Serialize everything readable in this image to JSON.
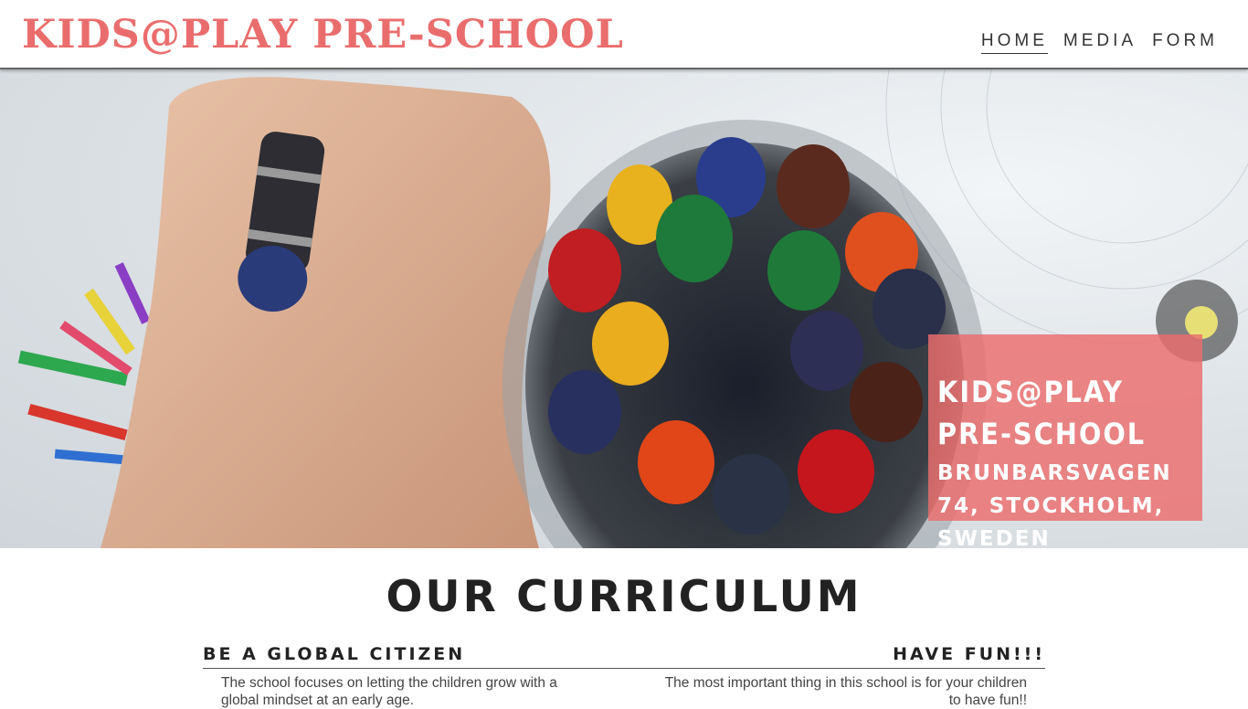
{
  "header": {
    "site_title": "KIDS@PLAY PRE-SCHOOL",
    "nav": [
      {
        "label": "HOME",
        "active": true
      },
      {
        "label": "MEDIA",
        "active": false
      },
      {
        "label": "FORM",
        "active": false
      }
    ]
  },
  "hero": {
    "image_description": "child coloring with crayons beside glass jar of crayons",
    "card_title": "KIDS@PLAY PRE-SCHOOL",
    "card_address": "BRUNBARSVAGEN 74, STOCKHOLM, SWEDEN"
  },
  "curriculum": {
    "title": "OUR CURRICULUM",
    "items": [
      {
        "heading": "BE A GLOBAL CITIZEN",
        "text": "The school focuses on letting the children grow with a global mindset at an early age."
      },
      {
        "heading": "HAVE FUN!!!",
        "text": "The most important thing in this school is for your children to have fun!!"
      }
    ]
  },
  "colors": {
    "brand": "#ea6d6d",
    "card_overlay": "#ec6c6c",
    "text": "#222222"
  }
}
